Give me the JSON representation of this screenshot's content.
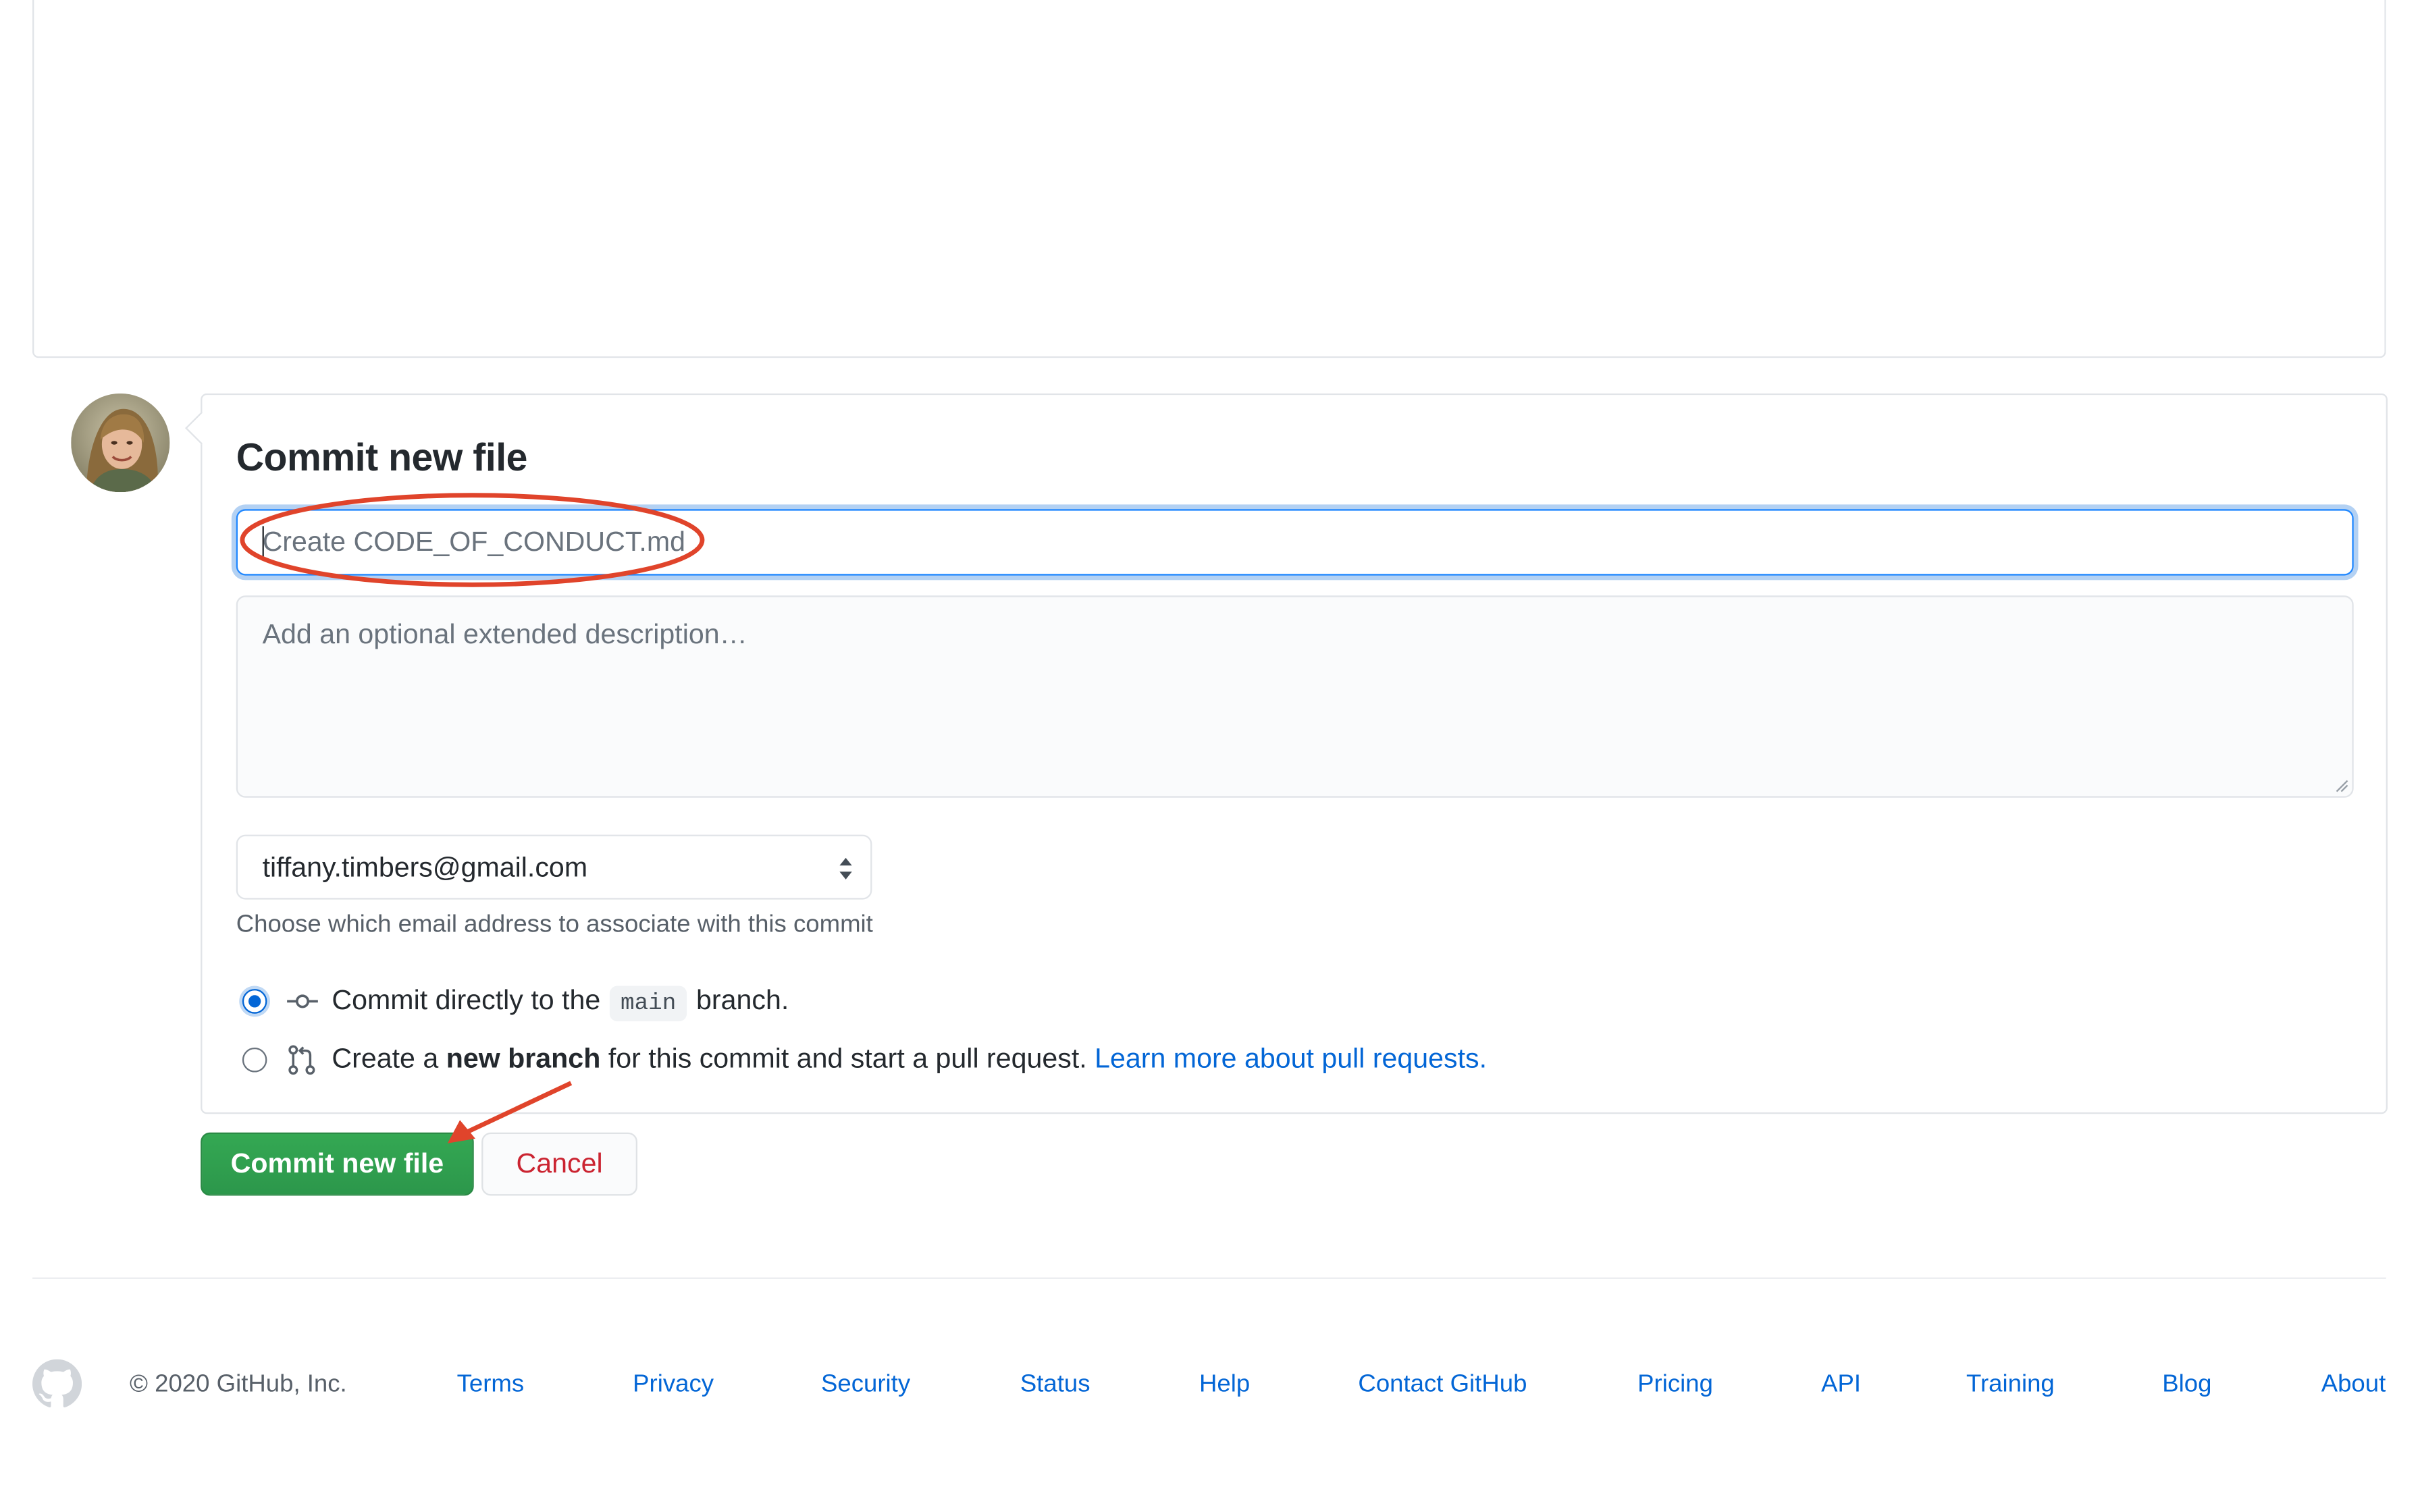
{
  "commit": {
    "title": "Commit new file",
    "summary_placeholder": "Create CODE_OF_CONDUCT.md",
    "summary_value": "",
    "description_placeholder": "Add an optional extended description…",
    "email_selected": "tiffany.timbers@gmail.com",
    "email_hint": "Choose which email address to associate with this commit",
    "option_direct": {
      "prefix": "Commit directly to the",
      "branch": "main",
      "suffix": "branch.",
      "checked": true
    },
    "option_new_branch": {
      "prefix": "Create a",
      "bold": "new branch",
      "suffix": "for this commit and start a pull request.",
      "link": "Learn more about pull requests.",
      "checked": false
    },
    "commit_button": "Commit new file",
    "cancel_button": "Cancel"
  },
  "footer": {
    "copyright": "© 2020 GitHub, Inc.",
    "links": [
      "Terms",
      "Privacy",
      "Security",
      "Status",
      "Help",
      "Contact GitHub",
      "Pricing",
      "API",
      "Training",
      "Blog",
      "About"
    ]
  },
  "colors": {
    "primary_green": "#2ea44f",
    "link_blue": "#0366d6",
    "danger_red": "#cb2431",
    "annotation_red": "#e0442b"
  },
  "icons": {
    "avatar": "user-avatar",
    "commit_icon": "git-commit-icon",
    "pull_request_icon": "git-pull-request-icon",
    "select_arrows": "select-arrows-icon",
    "footer_logo": "github-mark-icon"
  }
}
